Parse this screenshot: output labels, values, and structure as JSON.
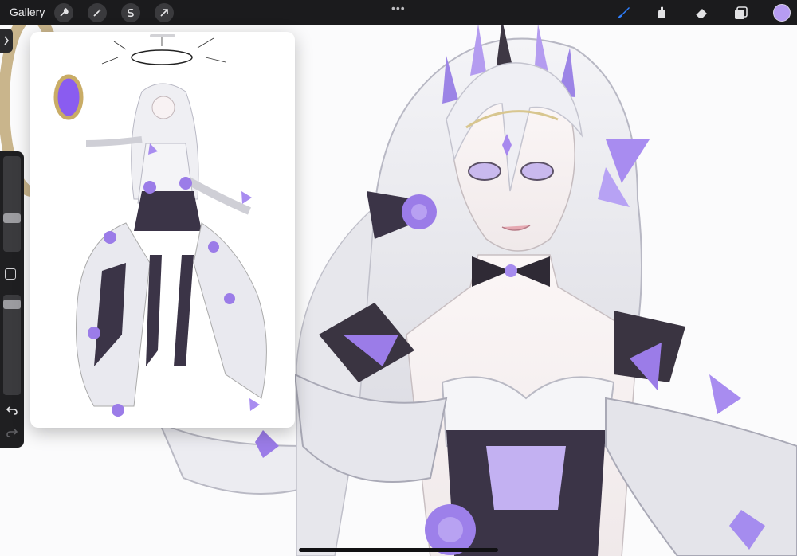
{
  "app": {
    "gallery_label": "Gallery",
    "more_dots": "•••"
  },
  "toolbar_left": [
    {
      "name": "actions",
      "icon": "wrench-icon"
    },
    {
      "name": "adjustments",
      "icon": "magic-wand-icon"
    },
    {
      "name": "selection",
      "icon": "selection-s-icon"
    },
    {
      "name": "transform",
      "icon": "arrow-cursor-icon"
    }
  ],
  "toolbar_right": [
    {
      "name": "brush",
      "icon": "brush-icon",
      "active": true
    },
    {
      "name": "smudge",
      "icon": "smudge-icon"
    },
    {
      "name": "eraser",
      "icon": "eraser-icon"
    },
    {
      "name": "layers",
      "icon": "layers-icon"
    }
  ],
  "colors": {
    "accent": "#2f80ff",
    "current_color": "#b69cf2",
    "primary_purple": "#9b7ce8",
    "hair": "#e9e9ee",
    "dark_fabric": "#3b3447"
  },
  "sidebar": {
    "brush_size_level": 0.55,
    "opacity_level": 0.93
  }
}
